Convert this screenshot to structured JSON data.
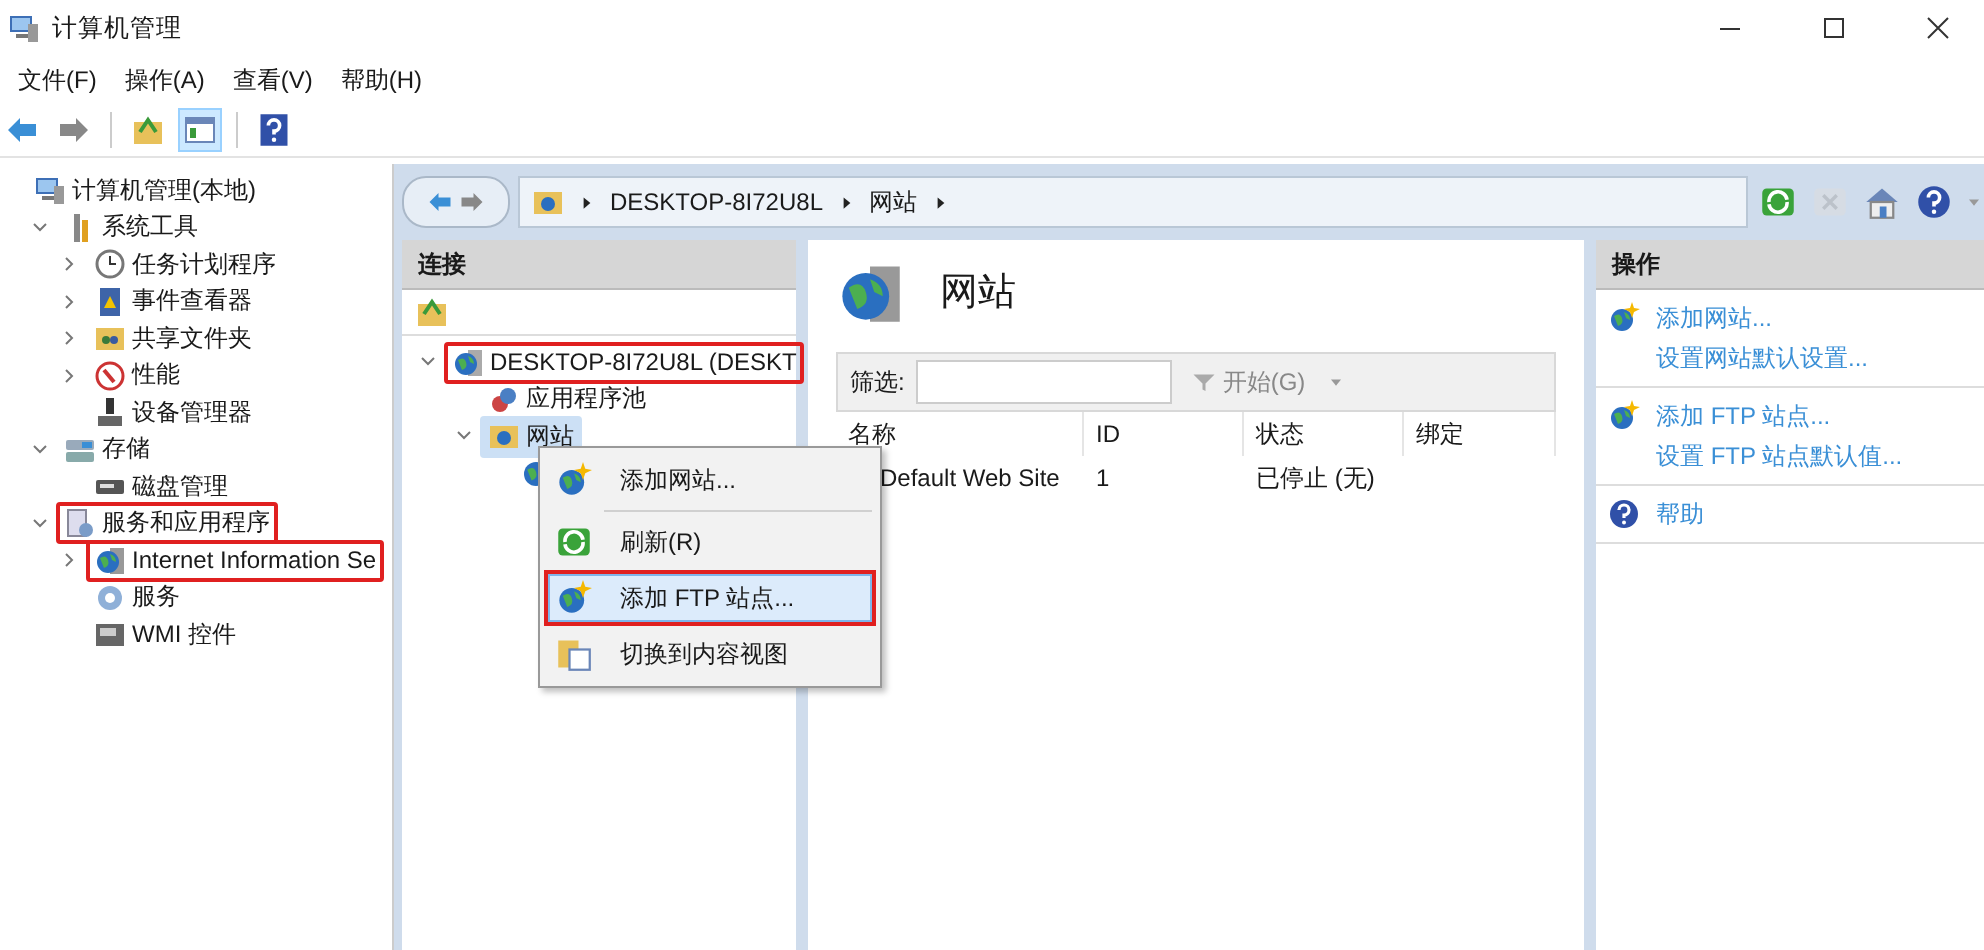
{
  "window": {
    "title": "计算机管理"
  },
  "menu_bar": [
    "文件(F)",
    "操作(A)",
    "查看(V)",
    "帮助(H)"
  ],
  "toolbar": [
    {
      "kind": "back",
      "pressed": false
    },
    {
      "kind": "forward",
      "pressed": false
    },
    {
      "kind": "up",
      "pressed": false
    },
    {
      "kind": "tree",
      "pressed": true
    },
    {
      "kind": "help",
      "pressed": false
    }
  ],
  "tree": {
    "label": "计算机管理(本地)",
    "kind": "computer",
    "highlighted": false,
    "children": [
      {
        "label": "系统工具",
        "kind": "tools",
        "expanded": true,
        "highlighted": false,
        "children": [
          {
            "label": "任务计划程序",
            "kind": "clock",
            "expanded": false,
            "highlighted": false
          },
          {
            "label": "事件查看器",
            "kind": "log",
            "expanded": false,
            "highlighted": false
          },
          {
            "label": "共享文件夹",
            "kind": "share",
            "expanded": false,
            "highlighted": false
          },
          {
            "label": "性能",
            "kind": "gauge",
            "expanded": false,
            "highlighted": false
          },
          {
            "label": "设备管理器",
            "kind": "device",
            "highlighted": false
          }
        ]
      },
      {
        "label": "存储",
        "kind": "storage",
        "expanded": true,
        "highlighted": false,
        "children": [
          {
            "label": "磁盘管理",
            "kind": "disk",
            "highlighted": false
          }
        ]
      },
      {
        "label": "服务和应用程序",
        "kind": "apps",
        "expanded": true,
        "highlighted": true,
        "children": [
          {
            "label": "Internet Information Se",
            "kind": "iis",
            "expanded": false,
            "highlighted": true
          },
          {
            "label": "服务",
            "kind": "service",
            "highlighted": false
          },
          {
            "label": "WMI 控件",
            "kind": "wmi",
            "highlighted": false
          }
        ]
      }
    ]
  },
  "address_bar": {
    "crumbs": [
      "DESKTOP-8I72U8L",
      "网站"
    ],
    "tools": [
      {
        "kind": "refresh",
        "disabled": false
      },
      {
        "kind": "stop",
        "disabled": true
      },
      {
        "kind": "home",
        "disabled": false
      },
      {
        "kind": "help",
        "disabled": false
      }
    ]
  },
  "connections": {
    "title": "连接",
    "tree": [
      {
        "label": "DESKTOP-8I72U8L (DESKT",
        "kind": "server",
        "expanded": true,
        "highlighted": true,
        "selected": false,
        "children": [
          {
            "label": "应用程序池",
            "kind": "pool",
            "highlighted": false,
            "selected": false
          },
          {
            "label": "网站",
            "kind": "sites",
            "expanded": true,
            "highlighted": false,
            "selected": true,
            "children": [
              {
                "kind": "site",
                "highlighted": false,
                "selected": false
              }
            ]
          }
        ]
      }
    ]
  },
  "center": {
    "title": "网站",
    "filter_label": "筛选:",
    "go_button": "开始(G)",
    "columns": [
      "名称",
      "ID",
      "状态",
      "绑定"
    ],
    "rows": [
      [
        "Default Web Site",
        "1",
        "已停止 (无)",
        null
      ]
    ]
  },
  "actions": {
    "title": "操作",
    "groups": [
      [
        {
          "label": "添加网站...",
          "kind": "globe-add"
        },
        {
          "label": "设置网站默认设置...",
          "kind": "plain"
        }
      ],
      [
        {
          "label": "添加 FTP 站点...",
          "kind": "globe-add"
        },
        {
          "label": "设置 FTP 站点默认值...",
          "kind": "plain"
        }
      ],
      [
        {
          "label": "帮助",
          "kind": "help"
        }
      ]
    ]
  },
  "context_menu": [
    {
      "label": "添加网站...",
      "kind": "globe-add",
      "selected": false,
      "highlighted": false,
      "separator_after": true
    },
    {
      "label": "刷新(R)",
      "kind": "refresh",
      "selected": false,
      "highlighted": false,
      "separator_after": false
    },
    {
      "label": "添加 FTP 站点...",
      "kind": "globe-add",
      "selected": true,
      "highlighted": true,
      "separator_after": false
    },
    {
      "label": "切换到内容视图",
      "kind": "content",
      "selected": false,
      "highlighted": false,
      "separator_after": false
    }
  ]
}
